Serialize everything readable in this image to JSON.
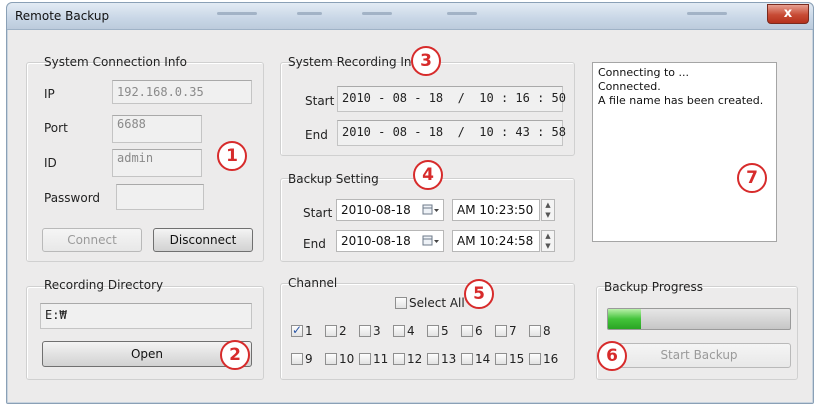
{
  "window": {
    "title": "Remote Backup",
    "close_label": "x"
  },
  "connection": {
    "title": "System Connection Info",
    "ip_label": "IP",
    "ip_value": "192.168.0.35",
    "port_label": "Port",
    "port_value": "6688",
    "id_label": "ID",
    "id_value": "admin",
    "password_label": "Password",
    "password_value": "",
    "connect_label": "Connect",
    "disconnect_label": "Disconnect"
  },
  "recording_dir": {
    "title": "Recording Directory",
    "path": "E:₩",
    "open_label": "Open"
  },
  "recording_info": {
    "title": "System Recording Info",
    "start_label": "Start",
    "start_value": "2010 - 08 - 18  /  10 : 16 : 50",
    "end_label": "End",
    "end_value": "2010 - 08 - 18  /  10 : 43 : 58"
  },
  "backup_setting": {
    "title": "Backup Setting",
    "start_label": "Start",
    "start_date": "2010-08-18",
    "start_time": "AM 10:23:50",
    "end_label": "End",
    "end_date": "2010-08-18",
    "end_time": "AM 10:24:58"
  },
  "channel": {
    "title": "Channel",
    "select_all_label": "Select All",
    "channels": [
      {
        "label": "1",
        "checked": true
      },
      {
        "label": "2",
        "checked": false
      },
      {
        "label": "3",
        "checked": false
      },
      {
        "label": "4",
        "checked": false
      },
      {
        "label": "5",
        "checked": false
      },
      {
        "label": "6",
        "checked": false
      },
      {
        "label": "7",
        "checked": false
      },
      {
        "label": "8",
        "checked": false
      },
      {
        "label": "9",
        "checked": false
      },
      {
        "label": "10",
        "checked": false
      },
      {
        "label": "11",
        "checked": false
      },
      {
        "label": "12",
        "checked": false
      },
      {
        "label": "13",
        "checked": false
      },
      {
        "label": "14",
        "checked": false
      },
      {
        "label": "15",
        "checked": false
      },
      {
        "label": "16",
        "checked": false
      }
    ]
  },
  "log": {
    "lines": [
      "Connecting to ...",
      "Connected.",
      "A file name has been created."
    ]
  },
  "progress": {
    "title": "Backup Progress",
    "fraction": 0.18,
    "start_backup_label": "Start Backup"
  },
  "callouts": [
    "1",
    "2",
    "3",
    "4",
    "5",
    "6",
    "7"
  ],
  "colors": {
    "callout": "#d72b2b",
    "progress_fill": "#43c43a"
  },
  "icons": {
    "calendar": "calendar-dropdown-icon",
    "spin": "spin-updown-icon",
    "close": "close-icon"
  }
}
